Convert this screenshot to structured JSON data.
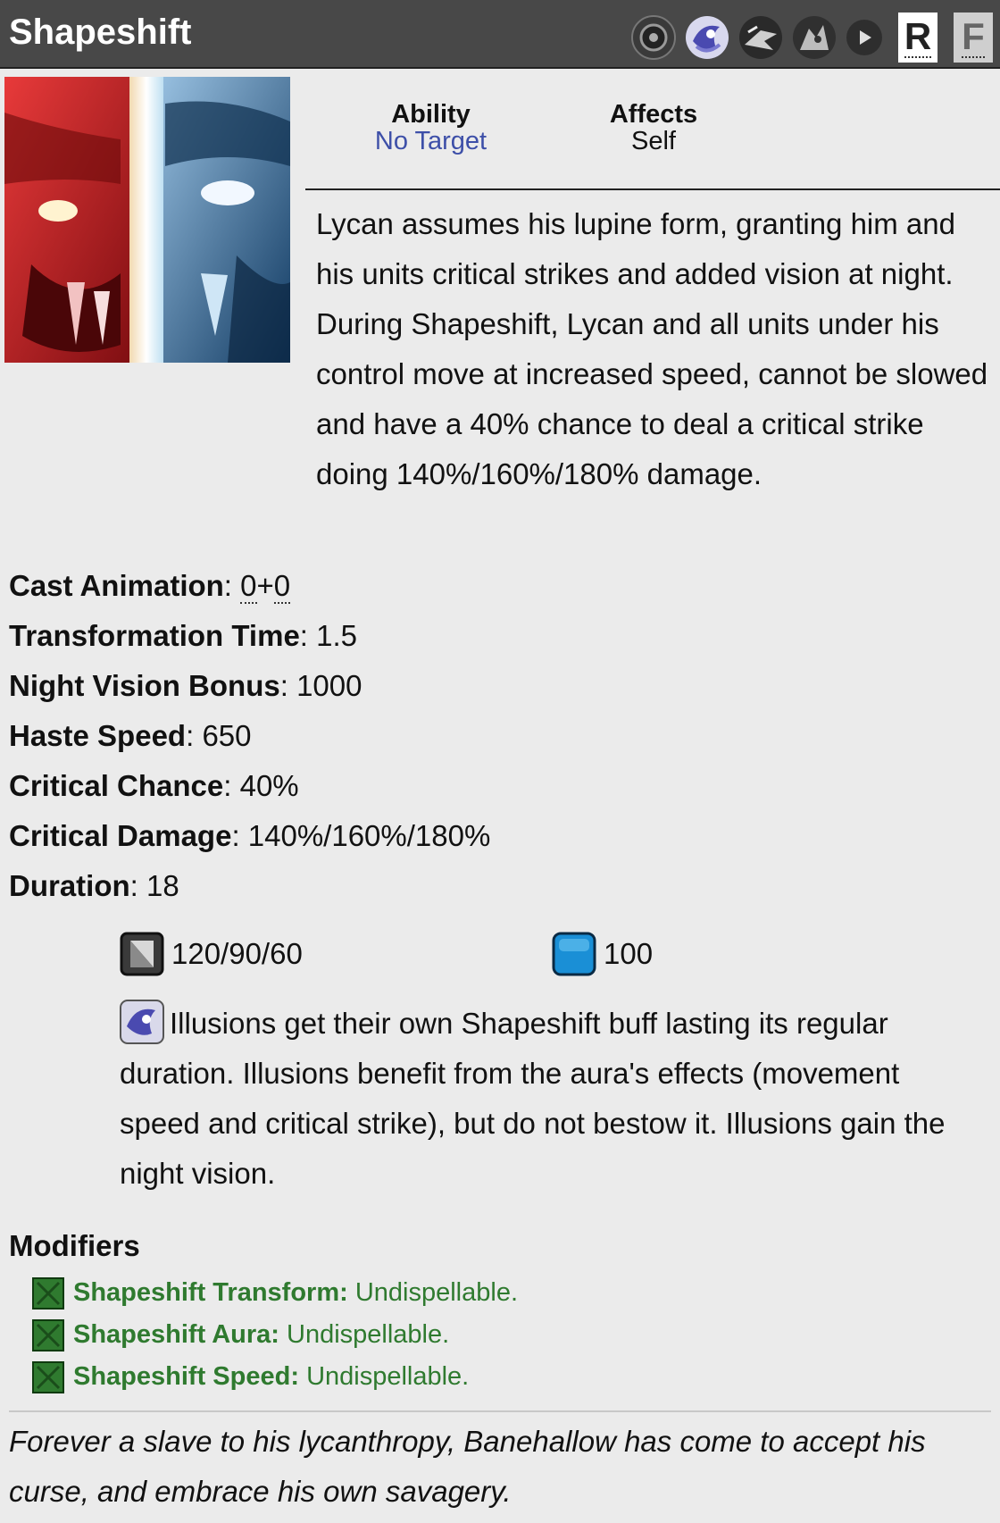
{
  "header": {
    "title": "Shapeshift",
    "icons": [
      "scepter-icon",
      "illusion-icon",
      "talent-icon-1",
      "talent-icon-2",
      "play-icon"
    ],
    "hotkey": "R",
    "legacy_key": "F"
  },
  "info": {
    "ability_label": "Ability",
    "ability_value": "No Target",
    "affects_label": "Affects",
    "affects_value": "Self"
  },
  "description": "Lycan assumes his lupine form, granting him and his units critical strikes and added vision at night. During Shapeshift, Lycan and all units under his control move at increased speed, cannot be slowed and have a 40% chance to deal a critical strike doing 140%/160%/180% damage.",
  "stats": {
    "cast_label": "Cast Animation",
    "cast_a": "0",
    "cast_b": "0",
    "transform_label": "Transformation Time",
    "transform_value": "1.5",
    "vision_label": "Night Vision Bonus",
    "vision_value": "1000",
    "haste_label": "Haste Speed",
    "haste_value": "650",
    "crit_chance_label": "Critical Chance",
    "crit_chance_value": "40%",
    "crit_damage_label": "Critical Damage",
    "crit_damage_value": "140%/160%/180%",
    "duration_label": "Duration",
    "duration_value": "18"
  },
  "costs": {
    "cooldown": "120/90/60",
    "mana": "100"
  },
  "illusion_note": "Illusions get their own Shapeshift buff lasting its regular duration. Illusions benefit from the aura's effects (movement speed and critical strike), but do not bestow it. Illusions gain the night vision.",
  "modifiers": {
    "title": "Modifiers",
    "items": [
      {
        "name": "Shapeshift Transform:",
        "value": "Undispellable."
      },
      {
        "name": "Shapeshift Aura:",
        "value": "Undispellable."
      },
      {
        "name": "Shapeshift Speed:",
        "value": "Undispellable."
      }
    ]
  },
  "lore": "Forever a slave to his lycanthropy, Banehallow has come to accept his curse, and embrace his own savagery.",
  "colors": {
    "header_bg": "#484848",
    "link": "#3d4fa8",
    "modifier_green": "#2f7a2f",
    "page_bg": "#ebebeb"
  }
}
